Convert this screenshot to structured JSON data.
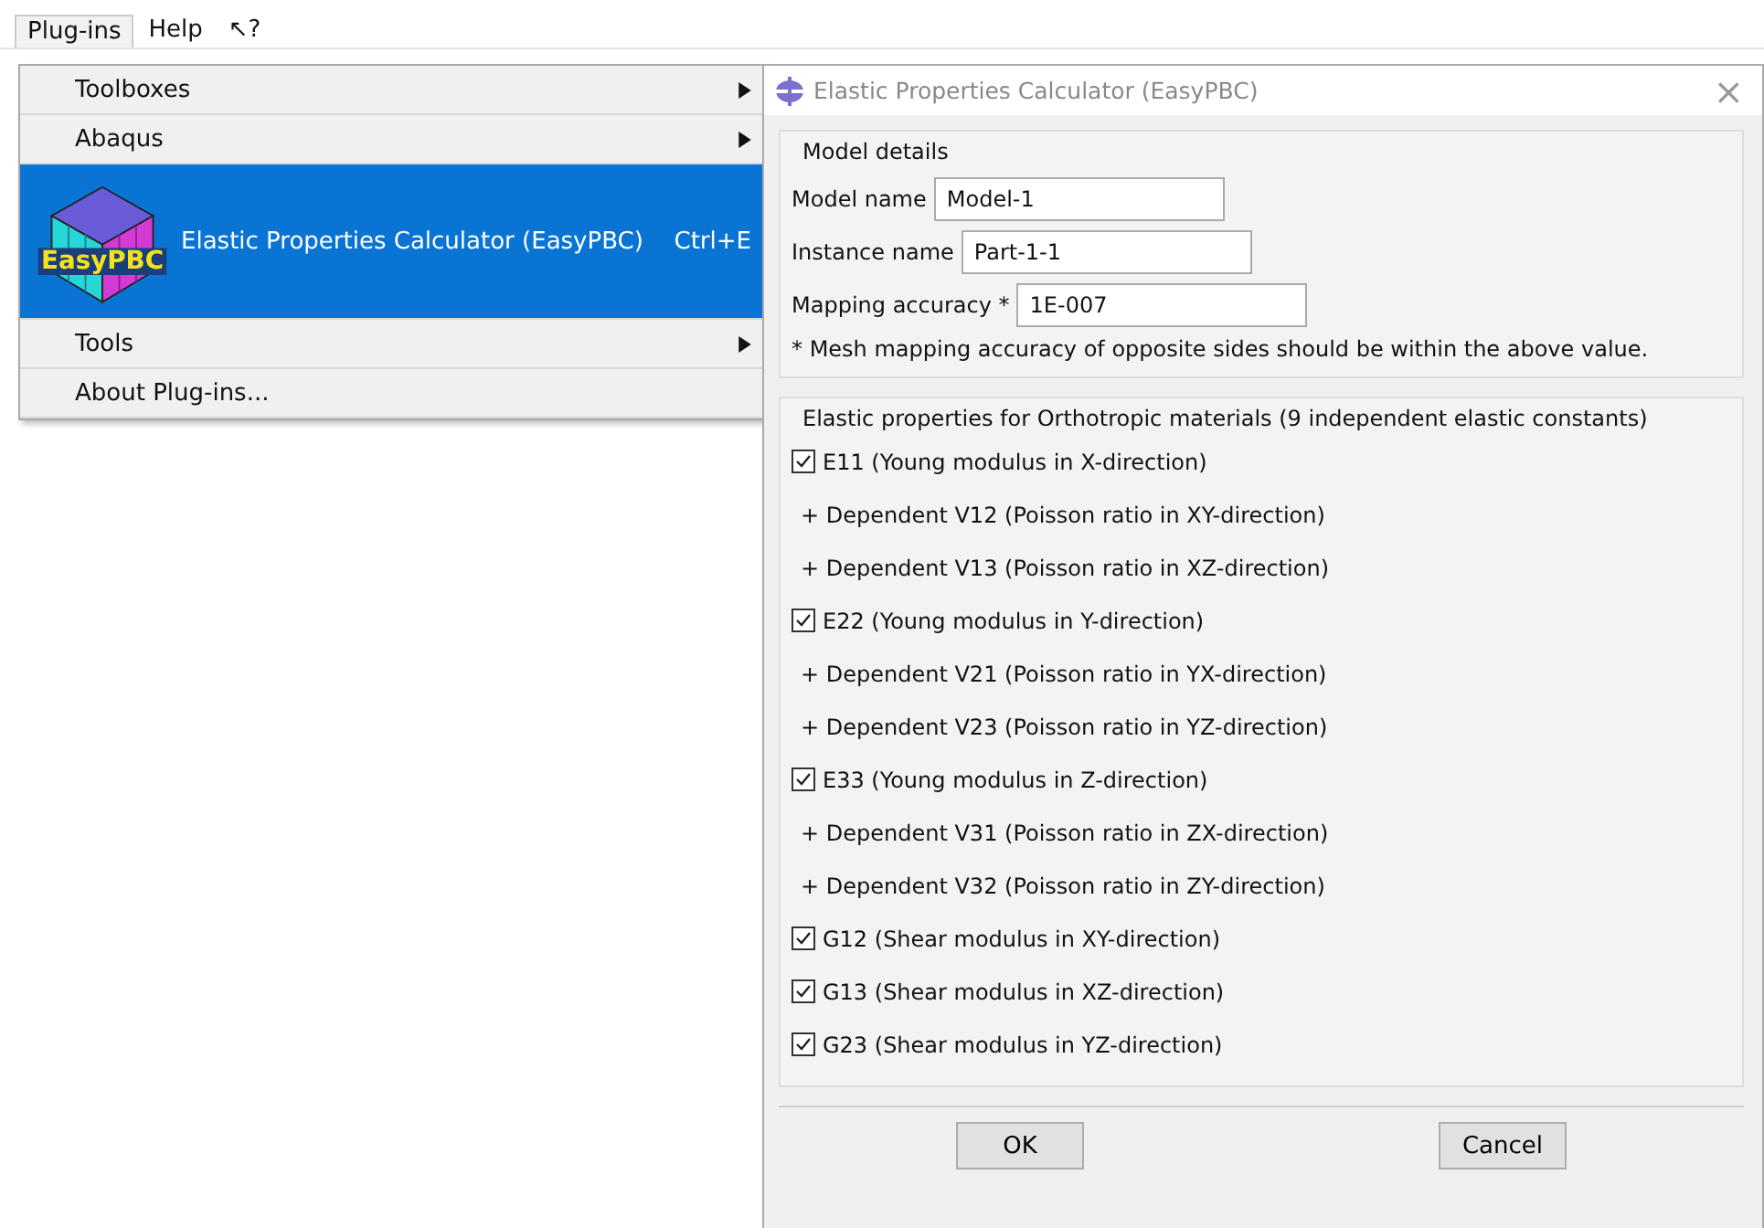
{
  "menubar": [
    {
      "label": "Plug-ins",
      "selected": true
    },
    {
      "label": "Help",
      "selected": false
    },
    {
      "label": "↖?",
      "selected": false
    }
  ],
  "menu": {
    "items": [
      {
        "label": "Toolboxes",
        "submenu": true,
        "highlighted": false
      },
      {
        "label": "Abaqus",
        "submenu": true,
        "highlighted": false
      },
      {
        "label": "Elastic Properties Calculator (EasyPBC)",
        "shortcut": "Ctrl+E",
        "logo_text": "EasyPBC",
        "submenu": false,
        "highlighted": true
      },
      {
        "label": "Tools",
        "submenu": true,
        "highlighted": false
      },
      {
        "label": "About Plug-ins...",
        "submenu": false,
        "highlighted": false
      }
    ]
  },
  "dialog": {
    "title": "Elastic Properties Calculator (EasyPBC)",
    "close": "×",
    "model_details": {
      "title": "Model details",
      "fields": [
        {
          "label": "Model name",
          "value": "Model-1"
        },
        {
          "label": "Instance name",
          "value": "Part-1-1"
        },
        {
          "label": "Mapping accuracy *",
          "value": "1E-007"
        }
      ],
      "note": "* Mesh mapping accuracy of opposite sides should be within the above value."
    },
    "elastic": {
      "title": "Elastic properties for Orthotropic materials (9 independent elastic constants)",
      "rows": [
        {
          "kind": "checkbox",
          "label": "E11 (Young modulus in X-direction)",
          "checked": true
        },
        {
          "kind": "dependent",
          "label": "+ Dependent V12 (Poisson ratio in XY-direction)"
        },
        {
          "kind": "dependent",
          "label": "+ Dependent V13 (Poisson ratio in XZ-direction)"
        },
        {
          "kind": "checkbox",
          "label": "E22 (Young modulus in Y-direction)",
          "checked": true
        },
        {
          "kind": "dependent",
          "label": "+ Dependent V21 (Poisson ratio in YX-direction)"
        },
        {
          "kind": "dependent",
          "label": "+ Dependent V23 (Poisson ratio in YZ-direction)"
        },
        {
          "kind": "checkbox",
          "label": "E33 (Young modulus in Z-direction)",
          "checked": true
        },
        {
          "kind": "dependent",
          "label": "+ Dependent V31 (Poisson ratio in ZX-direction)"
        },
        {
          "kind": "dependent",
          "label": "+ Dependent V32 (Poisson ratio in ZY-direction)"
        },
        {
          "kind": "checkbox",
          "label": "G12 (Shear modulus in XY-direction)",
          "checked": true
        },
        {
          "kind": "checkbox",
          "label": "G13 (Shear modulus in XZ-direction)",
          "checked": true
        },
        {
          "kind": "checkbox",
          "label": "G23 (Shear modulus in YZ-direction)",
          "checked": true
        }
      ]
    },
    "buttons": [
      "OK",
      "Cancel"
    ]
  }
}
